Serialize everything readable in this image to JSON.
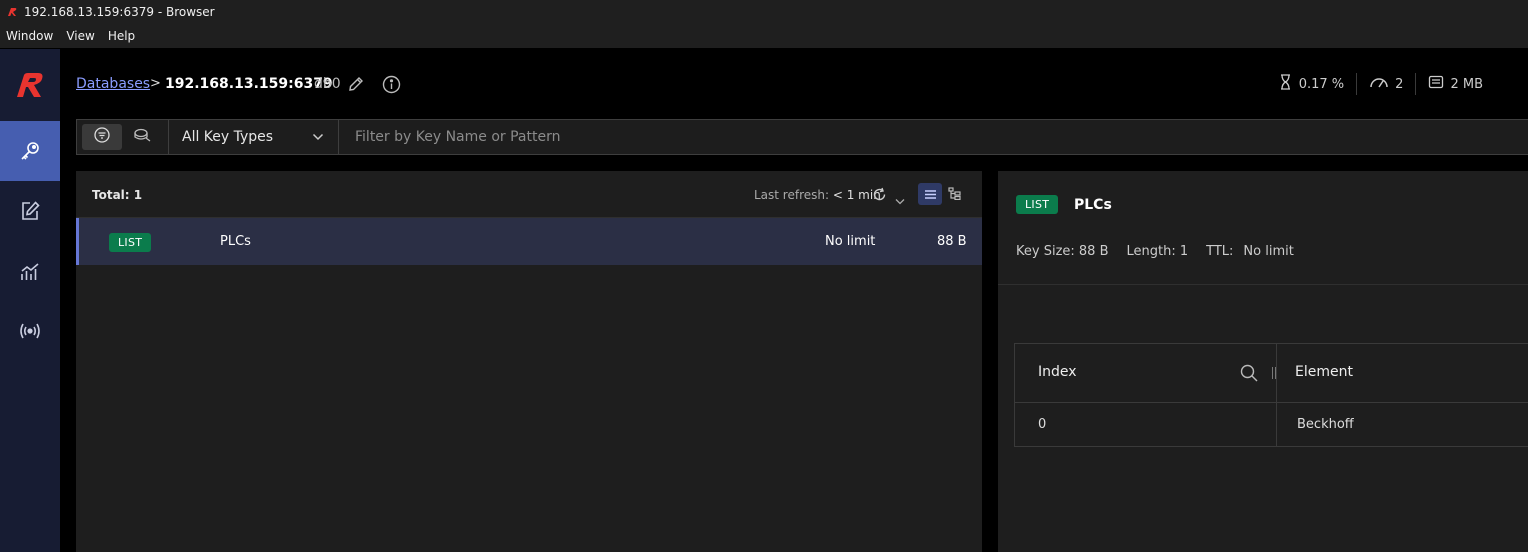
{
  "window": {
    "title": "192.168.13.159:6379 - Browser"
  },
  "menu": {
    "items": [
      "Window",
      "View",
      "Help"
    ]
  },
  "sidebar": {
    "logo": "redis-logo-icon",
    "items": [
      {
        "name": "browser",
        "icon": "key-icon",
        "active": true
      },
      {
        "name": "workbench",
        "icon": "edit-icon",
        "active": false
      },
      {
        "name": "analysis",
        "icon": "chart-icon",
        "active": false
      },
      {
        "name": "pubsub",
        "icon": "broadcast-icon",
        "active": false
      }
    ]
  },
  "header": {
    "breadcrumb_link": "Databases",
    "breadcrumb_sep": ">",
    "host": "192.168.13.159:6379",
    "db": "db0",
    "stats": {
      "cpu": "0.17 %",
      "clients": "2",
      "memory": "2 MB"
    }
  },
  "filter": {
    "key_type": "All Key Types",
    "search_placeholder": "Filter by Key Name or Pattern"
  },
  "keylist": {
    "total": "Total: 1",
    "refresh_label": "Last refresh: ",
    "refresh_value": "< 1 min",
    "rows": [
      {
        "type": "LIST",
        "name": "PLCs",
        "ttl": "No limit",
        "size": "88 B"
      }
    ]
  },
  "detail": {
    "type": "LIST",
    "name": "PLCs",
    "key_size": "Key Size: 88 B",
    "length": "Length: 1",
    "ttl_label": "TTL:",
    "ttl_value": "No limit",
    "columns": [
      "Index",
      "Element"
    ],
    "rows": [
      {
        "index": "0",
        "element": "Beckhoff"
      }
    ]
  },
  "colors": {
    "accent": "#465eb0",
    "badge": "#0b7c4c",
    "link": "#8a9cff",
    "sidebar": "#171c33"
  }
}
